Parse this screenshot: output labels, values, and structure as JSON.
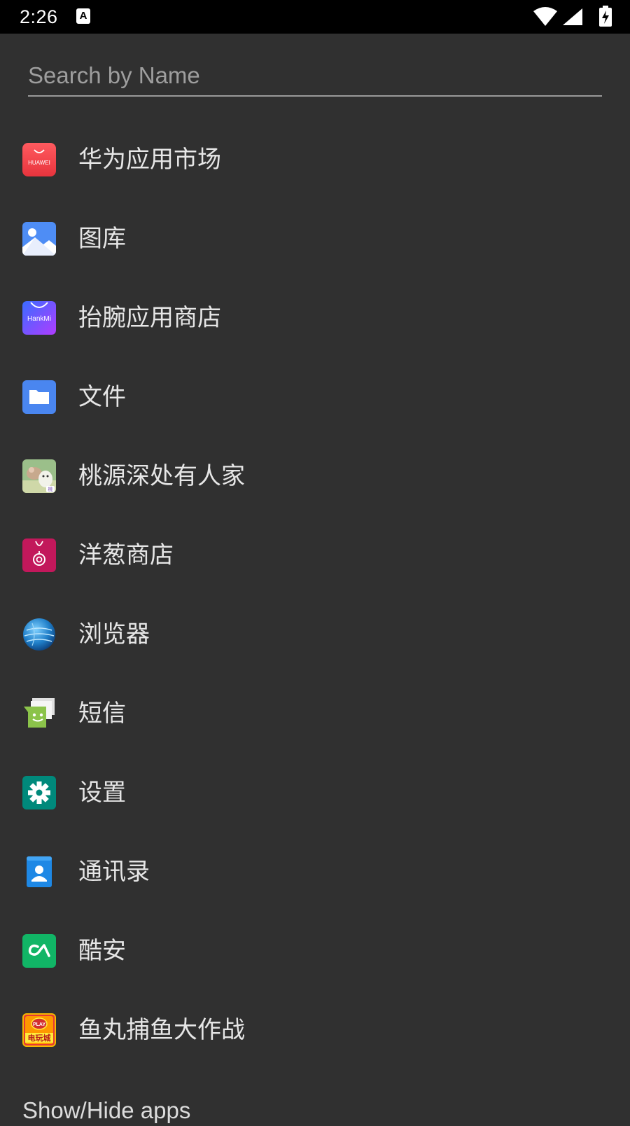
{
  "status_bar": {
    "time": "2:26",
    "notification_icon_letter": "A",
    "icons": [
      "wifi-icon",
      "signal-icon",
      "battery-charging-icon"
    ]
  },
  "search": {
    "value": "",
    "placeholder": "Search by Name"
  },
  "apps": [
    {
      "label": "华为应用市场",
      "icon": "huawei-appgallery-icon",
      "icon_text": "HUAWEI"
    },
    {
      "label": "图库",
      "icon": "gallery-icon"
    },
    {
      "label": "抬腕应用商店",
      "icon": "hankmi-store-icon",
      "icon_text": "HankMi"
    },
    {
      "label": "文件",
      "icon": "files-icon"
    },
    {
      "label": "桃源深处有人家",
      "icon": "taoyuan-game-icon"
    },
    {
      "label": "洋葱商店",
      "icon": "onion-store-icon"
    },
    {
      "label": "浏览器",
      "icon": "browser-globe-icon"
    },
    {
      "label": "短信",
      "icon": "messages-icon"
    },
    {
      "label": "设置",
      "icon": "settings-gear-icon"
    },
    {
      "label": "通讯录",
      "icon": "contacts-icon"
    },
    {
      "label": "酷安",
      "icon": "coolapk-icon"
    },
    {
      "label": "鱼丸捕鱼大作战",
      "icon": "fishing-game-icon",
      "icon_text": "电玩城"
    }
  ],
  "footer": {
    "show_hide_label": "Show/Hide apps"
  },
  "colors": {
    "background": "#303030",
    "status_bar": "#000000",
    "text": "#e6e6e6",
    "placeholder": "#9e9e9e"
  }
}
